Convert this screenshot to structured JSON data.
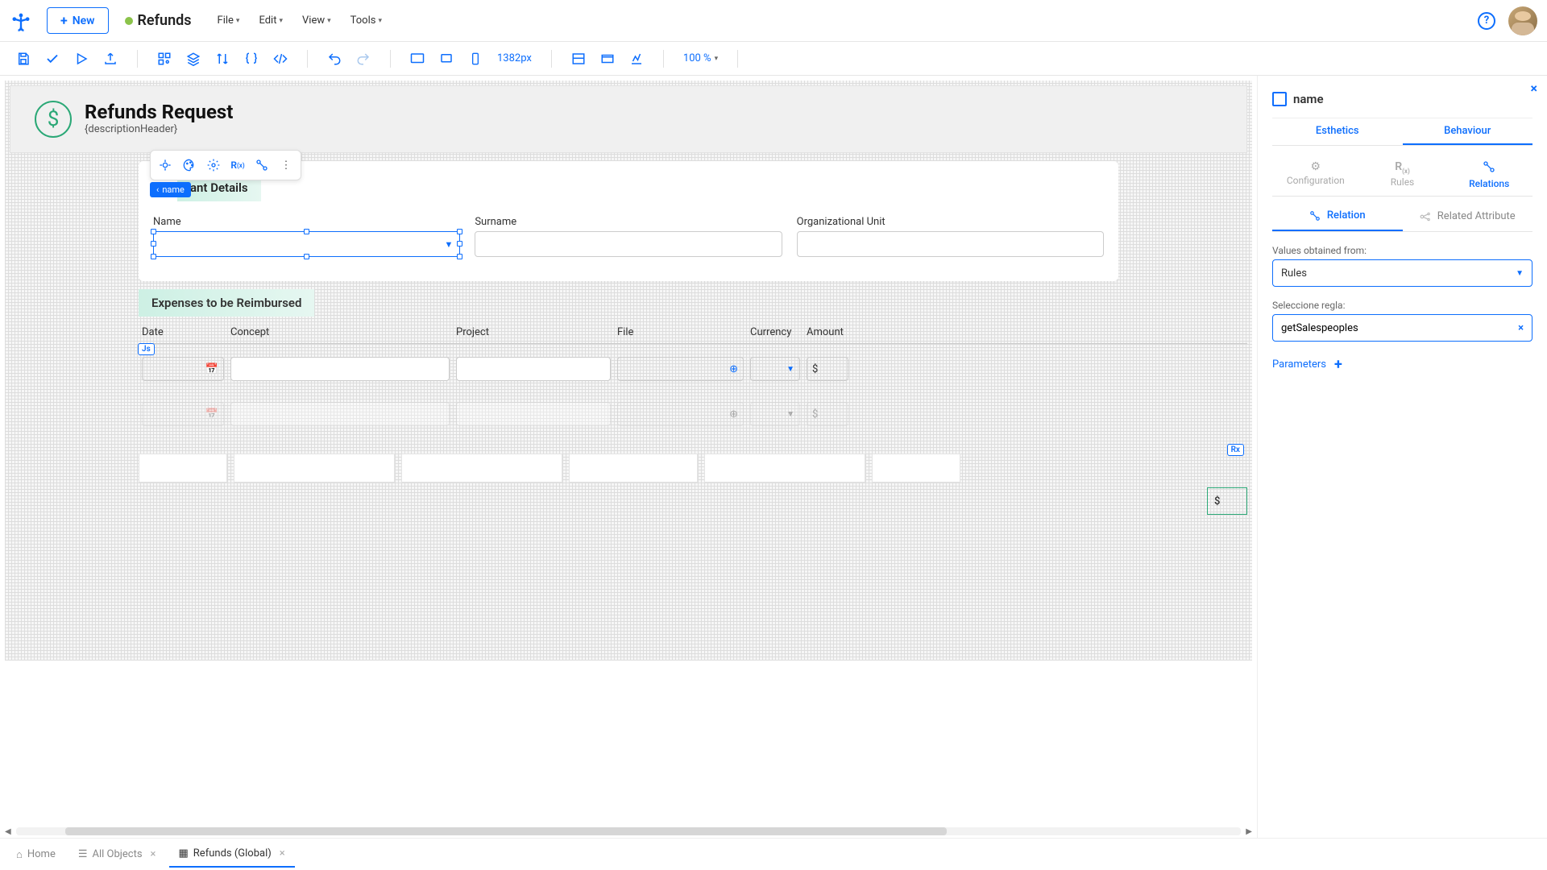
{
  "header": {
    "new_label": "New",
    "breadcrumb": "Refunds",
    "menus": [
      "File",
      "Edit",
      "View",
      "Tools"
    ]
  },
  "toolbar": {
    "pixel_label": "1382px",
    "zoom": "100 %"
  },
  "form": {
    "title": "Refunds Request",
    "subtitle": "{descriptionHeader}",
    "selected_tag": "name",
    "applicant_section_title": "ant Details",
    "fields": {
      "name_label": "Name",
      "surname_label": "Surname",
      "org_label": "Organizational Unit"
    }
  },
  "expenses": {
    "title": "Expenses to be Reimbursed",
    "cols": {
      "date": "Date",
      "concept": "Concept",
      "project": "Project",
      "file": "File",
      "currency": "Currency",
      "amount": "Amount"
    },
    "js_tag": "Js",
    "rx_tag": "Rx",
    "dollar": "$"
  },
  "panel": {
    "title": "name",
    "tabs": {
      "esthetics": "Esthetics",
      "behaviour": "Behaviour"
    },
    "subtabs": {
      "config": "Configuration",
      "rules": "Rules",
      "relations": "Relations"
    },
    "seg": {
      "relation": "Relation",
      "related_attr": "Related Attribute"
    },
    "values_label": "Values obtained from:",
    "values_value": "Rules",
    "rule_label": "Seleccione regla:",
    "rule_value": "getSalespeoples",
    "parameters_label": "Parameters"
  },
  "bottom": {
    "home": "Home",
    "all_objects": "All Objects",
    "refunds": "Refunds (Global)"
  }
}
